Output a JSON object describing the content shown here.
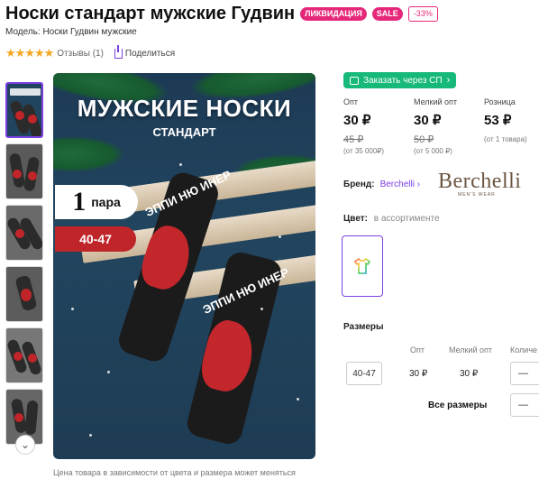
{
  "header": {
    "title": "Носки стандарт мужские Гудвин",
    "badges": {
      "clearance": "ЛИКВИДАЦИЯ",
      "sale": "SALE",
      "discount": "-33%"
    },
    "model": "Модель: Носки Гудвин мужские"
  },
  "rating": {
    "stars": "★★★★★",
    "reviews": "Отзывы (1)",
    "share": "Поделиться"
  },
  "image": {
    "title": "МУЖСКИЕ НОСКИ",
    "subtitle": "СТАНДАРТ",
    "pair_num": "1",
    "pair_word": "пара",
    "size": "40-47",
    "sock_text_1": "ЭППИ НЮ ИНЕР",
    "sock_text_2": "ЭППИ НЮ ИНЕР",
    "caption": "Цена товара в зависимости от цвета и размера может меняться"
  },
  "thumbs_down_icon": "⌄",
  "sp_button": "Заказать через СП",
  "prices": [
    {
      "label": "Опт",
      "value": "30 ₽",
      "old": "45 ₽",
      "note": "(от 35 000₽)"
    },
    {
      "label": "Мелкий опт",
      "value": "30 ₽",
      "old": "50 ₽",
      "note": "(от 5 000 ₽)"
    },
    {
      "label": "Розница",
      "value": "53 ₽",
      "old": "",
      "note": "(от 1 товара)"
    }
  ],
  "brand": {
    "label": "Бренд:",
    "name": "Berchelli",
    "logo": "Berchelli",
    "logo_sub": "MEN'S WEAR"
  },
  "color": {
    "label": "Цвет:",
    "value": "в ассортименте"
  },
  "sizes": {
    "title": "Размеры",
    "headers": {
      "opt": "Опт",
      "small_opt": "Мелкий опт",
      "qty": "Количе"
    },
    "row": {
      "size": "40-47",
      "opt": "30 ₽",
      "small_opt": "30 ₽",
      "qty": "—"
    },
    "all_label": "Все размеры",
    "all_qty": "—"
  },
  "colors": {
    "accent": "#7b3fe4",
    "pink": "#e6287a",
    "green": "#17b978",
    "red": "#c0252a"
  }
}
